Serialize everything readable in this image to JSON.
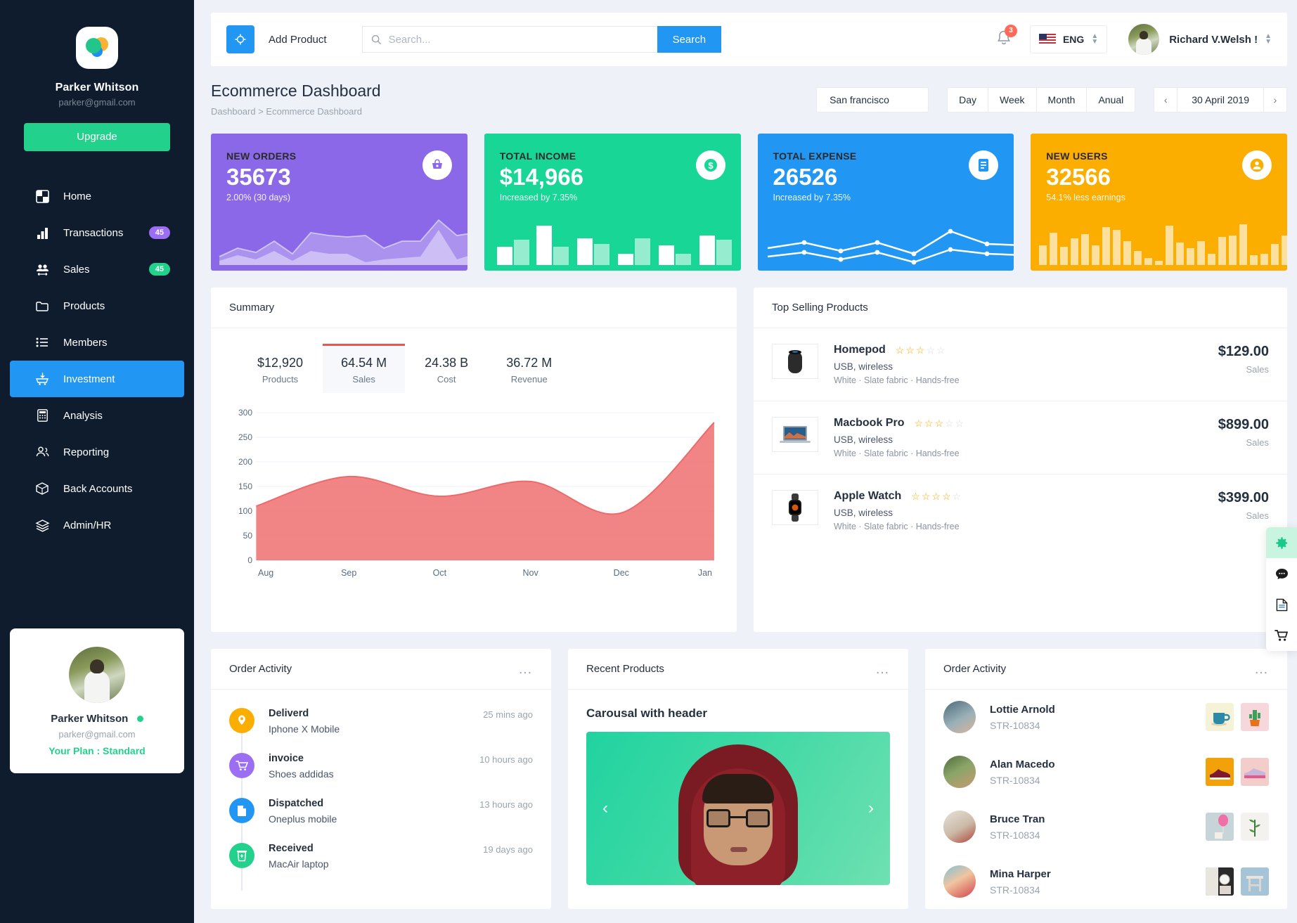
{
  "sidebar": {
    "brand": {
      "name": "Parker Whitson",
      "email": "parker@gmail.com",
      "logo_icon": "app-logo-icon"
    },
    "upgrade_label": "Upgrade",
    "items": [
      {
        "label": "Home",
        "icon": "home-icon",
        "badge": null,
        "active": false
      },
      {
        "label": "Transactions",
        "icon": "bar-chart-icon",
        "badge": "45",
        "badge_color": "#9b6ef3",
        "active": false
      },
      {
        "label": "Sales",
        "icon": "people-icon",
        "badge": "45",
        "badge_color": "#22d18c",
        "active": false
      },
      {
        "label": "Products",
        "icon": "folder-icon",
        "badge": null,
        "active": false
      },
      {
        "label": "Members",
        "icon": "list-icon",
        "badge": null,
        "active": false
      },
      {
        "label": "Investment",
        "icon": "cart-download-icon",
        "badge": null,
        "active": true
      },
      {
        "label": "Analysis",
        "icon": "calculator-icon",
        "badge": null,
        "active": false
      },
      {
        "label": "Reporting",
        "icon": "users-icon",
        "badge": null,
        "active": false
      },
      {
        "label": "Back Accounts",
        "icon": "box-icon",
        "badge": null,
        "active": false
      },
      {
        "label": "Admin/HR",
        "icon": "layers-icon",
        "badge": null,
        "active": false
      }
    ],
    "profile_card": {
      "name": "Parker Whitson",
      "email": "parker@gmail.com",
      "plan": "Your Plan : Standard",
      "status": "online"
    }
  },
  "topbar": {
    "add_product_label": "Add Product",
    "add_product_icon": "plus-target-icon",
    "search_placeholder": "Search...",
    "search_value": "",
    "search_icon": "search-icon",
    "search_button_label": "Search",
    "notification_icon": "bell-icon",
    "notification_count": "3",
    "language": "ENG",
    "language_flag": "us-flag-icon",
    "user_name": "Richard V.Welsh !",
    "user_avatar": "avatar"
  },
  "page": {
    "title": "Ecommerce Dashboard",
    "breadcrumb": "Dashboard > Ecommerce Dashboard",
    "city": "San francisco",
    "range_buttons": [
      "Day",
      "Week",
      "Month",
      "Anual"
    ],
    "date": "30 April 2019",
    "prev_icon": "chevron-left-icon",
    "next_icon": "chevron-right-icon"
  },
  "stats": [
    {
      "label": "NEW ORDERS",
      "value": "35673",
      "sub": "2.00% (30 days)",
      "color": "#8a68e8",
      "icon": "basket-icon",
      "spark": "area"
    },
    {
      "label": "TOTAL INCOME",
      "value": "$14,966",
      "sub": "Increased by 7.35%",
      "color": "#18d696",
      "icon": "dollar-icon",
      "spark": "bars"
    },
    {
      "label": "TOTAL EXPENSE",
      "value": "26526",
      "sub": "Increased by 7.35%",
      "color": "#2196f3",
      "icon": "document-icon",
      "spark": "lines"
    },
    {
      "label": "NEW USERS",
      "value": "32566",
      "sub": "54.1% less earnings",
      "color": "#fbad00",
      "icon": "user-circle-icon",
      "spark": "bars2"
    }
  ],
  "summary": {
    "title": "Summary",
    "metrics": [
      {
        "value": "$12,920",
        "label": "Products",
        "active": false
      },
      {
        "value": "64.54 M",
        "label": "Sales",
        "active": true
      },
      {
        "value": "24.38 B",
        "label": "Cost",
        "active": false
      },
      {
        "value": "36.72 M",
        "label": "Revenue",
        "active": false
      }
    ]
  },
  "chart_data": {
    "type": "area",
    "title": "Summary",
    "categories": [
      "Aug",
      "Sep",
      "Oct",
      "Nov",
      "Dec",
      "Jan"
    ],
    "series": [
      {
        "name": "Sales",
        "values": [
          110,
          170,
          130,
          160,
          97,
          280
        ],
        "color": "#ee6a6a"
      }
    ],
    "xlabel": "",
    "ylabel": "",
    "ylim": [
      0,
      300
    ],
    "yticks": [
      0,
      50,
      100,
      150,
      200,
      250,
      300
    ],
    "grid": true,
    "legend": "none"
  },
  "top_selling": {
    "title": "Top Selling Products",
    "products": [
      {
        "name": "Homepod",
        "rating": 3,
        "max_rating": 5,
        "spec": "USB, wireless",
        "detail": "White · Slate fabric · Hands-free",
        "price": "$129.00",
        "price_label": "Sales",
        "thumb": "homepod-thumb"
      },
      {
        "name": "Macbook Pro",
        "rating": 3,
        "max_rating": 5,
        "spec": "USB, wireless",
        "detail": "White · Slate fabric · Hands-free",
        "price": "$899.00",
        "price_label": "Sales",
        "thumb": "macbook-thumb"
      },
      {
        "name": "Apple Watch",
        "rating": 4,
        "max_rating": 5,
        "spec": "USB, wireless",
        "detail": "White · Slate fabric · Hands-free",
        "price": "$399.00",
        "price_label": "Sales",
        "thumb": "applewatch-thumb"
      }
    ]
  },
  "order_activity": {
    "title": "Order Activity",
    "menu_icon": "more-dots-icon",
    "items": [
      {
        "title": "Deliverd",
        "subtitle": "Iphone X Mobile",
        "time": "25 mins ago",
        "color": "#fbad00",
        "icon": "location-pin-icon"
      },
      {
        "title": "invoice",
        "subtitle": "Shoes addidas",
        "time": "10 hours ago",
        "color": "#9b6ef3",
        "icon": "cart-icon"
      },
      {
        "title": "Dispatched",
        "subtitle": "Oneplus mobile",
        "time": "13 hours ago",
        "color": "#2196f3",
        "icon": "document-icon"
      },
      {
        "title": "Received",
        "subtitle": "MacAir laptop",
        "time": "19 days ago",
        "color": "#22d18c",
        "icon": "delete-icon"
      }
    ]
  },
  "recent_products": {
    "title": "Recent Products",
    "menu_icon": "more-dots-icon",
    "carousel_title": "Carousal with header",
    "prev_icon": "chevron-left-icon",
    "next_icon": "chevron-right-icon"
  },
  "order_activity_users": {
    "title": "Order Activity",
    "menu_icon": "more-dots-icon",
    "rows": [
      {
        "name": "Lottie Arnold",
        "id": "STR-10834",
        "thumb1": "mug-thumb",
        "thumb2": "cactus-thumb"
      },
      {
        "name": "Alan Macedo",
        "id": "STR-10834",
        "thumb1": "sneaker-thumb",
        "thumb2": "shoe-thumb"
      },
      {
        "name": "Bruce Tran",
        "id": "STR-10834",
        "thumb1": "balloon-thumb",
        "thumb2": "plant-thumb"
      },
      {
        "name": "Mina Harper",
        "id": "STR-10834",
        "thumb1": "clock-thumb",
        "thumb2": "stool-thumb"
      }
    ]
  },
  "fab_rail": [
    {
      "icon": "gear-icon",
      "selected": true
    },
    {
      "icon": "chat-icon",
      "selected": false
    },
    {
      "icon": "document-icon",
      "selected": false
    },
    {
      "icon": "cart-icon",
      "selected": false
    }
  ]
}
